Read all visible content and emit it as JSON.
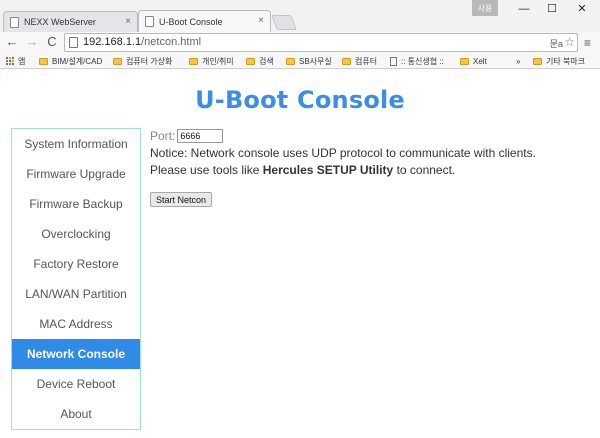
{
  "window": {
    "user_badge": "사용",
    "minimize": "—",
    "maximize": "☐",
    "close": "✕"
  },
  "tabs": [
    {
      "title": "NEXX WebServer",
      "close": "×"
    },
    {
      "title": "U-Boot Console",
      "close": "×"
    }
  ],
  "toolbar": {
    "back": "←",
    "forward": "→",
    "reload": "C",
    "url_host": "192.168.1.1",
    "url_path": "/netcon.html",
    "translate": "문a",
    "star": "☆",
    "menu": "≡"
  },
  "bookmarks": {
    "items": [
      "앱",
      "BIM/설계/CAD",
      "컴퓨터 가상화",
      "개인/취미",
      "검색",
      "SB사무실",
      "컴퓨터",
      ":: 통신생협 ::",
      "Xelt"
    ],
    "overflow": "»",
    "other": "기타 북마크"
  },
  "page": {
    "title": "U-Boot Console",
    "sidebar": [
      "System Information",
      "Firmware Upgrade",
      "Firmware Backup",
      "Overclocking",
      "Factory Restore",
      "LAN/WAN Partition",
      "MAC Address",
      "Network Console",
      "Device Reboot",
      "About"
    ],
    "active_item": "Network Console",
    "port_label": "Port:",
    "port_value": "6666",
    "notice": "Notice: Network console uses UDP protocol to communicate with clients.",
    "tools_prefix": "Please use tools like ",
    "tools_bold": "Hercules SETUP Utility",
    "tools_suffix": " to connect.",
    "start_button": "Start Netcon"
  },
  "colors": {
    "accent": "#2f8be6",
    "title": "#3b8ee6",
    "sidebar_border": "#9fe3d2"
  }
}
